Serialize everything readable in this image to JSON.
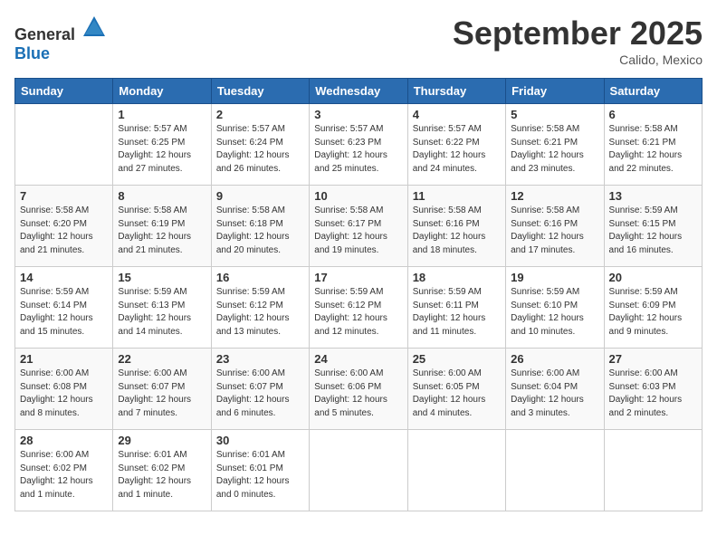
{
  "header": {
    "logo_general": "General",
    "logo_blue": "Blue",
    "title": "September 2025",
    "location": "Calido, Mexico"
  },
  "days_of_week": [
    "Sunday",
    "Monday",
    "Tuesday",
    "Wednesday",
    "Thursday",
    "Friday",
    "Saturday"
  ],
  "weeks": [
    [
      {
        "day": "",
        "info": ""
      },
      {
        "day": "1",
        "info": "Sunrise: 5:57 AM\nSunset: 6:25 PM\nDaylight: 12 hours\nand 27 minutes."
      },
      {
        "day": "2",
        "info": "Sunrise: 5:57 AM\nSunset: 6:24 PM\nDaylight: 12 hours\nand 26 minutes."
      },
      {
        "day": "3",
        "info": "Sunrise: 5:57 AM\nSunset: 6:23 PM\nDaylight: 12 hours\nand 25 minutes."
      },
      {
        "day": "4",
        "info": "Sunrise: 5:57 AM\nSunset: 6:22 PM\nDaylight: 12 hours\nand 24 minutes."
      },
      {
        "day": "5",
        "info": "Sunrise: 5:58 AM\nSunset: 6:21 PM\nDaylight: 12 hours\nand 23 minutes."
      },
      {
        "day": "6",
        "info": "Sunrise: 5:58 AM\nSunset: 6:21 PM\nDaylight: 12 hours\nand 22 minutes."
      }
    ],
    [
      {
        "day": "7",
        "info": "Sunrise: 5:58 AM\nSunset: 6:20 PM\nDaylight: 12 hours\nand 21 minutes."
      },
      {
        "day": "8",
        "info": "Sunrise: 5:58 AM\nSunset: 6:19 PM\nDaylight: 12 hours\nand 21 minutes."
      },
      {
        "day": "9",
        "info": "Sunrise: 5:58 AM\nSunset: 6:18 PM\nDaylight: 12 hours\nand 20 minutes."
      },
      {
        "day": "10",
        "info": "Sunrise: 5:58 AM\nSunset: 6:17 PM\nDaylight: 12 hours\nand 19 minutes."
      },
      {
        "day": "11",
        "info": "Sunrise: 5:58 AM\nSunset: 6:16 PM\nDaylight: 12 hours\nand 18 minutes."
      },
      {
        "day": "12",
        "info": "Sunrise: 5:58 AM\nSunset: 6:16 PM\nDaylight: 12 hours\nand 17 minutes."
      },
      {
        "day": "13",
        "info": "Sunrise: 5:59 AM\nSunset: 6:15 PM\nDaylight: 12 hours\nand 16 minutes."
      }
    ],
    [
      {
        "day": "14",
        "info": "Sunrise: 5:59 AM\nSunset: 6:14 PM\nDaylight: 12 hours\nand 15 minutes."
      },
      {
        "day": "15",
        "info": "Sunrise: 5:59 AM\nSunset: 6:13 PM\nDaylight: 12 hours\nand 14 minutes."
      },
      {
        "day": "16",
        "info": "Sunrise: 5:59 AM\nSunset: 6:12 PM\nDaylight: 12 hours\nand 13 minutes."
      },
      {
        "day": "17",
        "info": "Sunrise: 5:59 AM\nSunset: 6:12 PM\nDaylight: 12 hours\nand 12 minutes."
      },
      {
        "day": "18",
        "info": "Sunrise: 5:59 AM\nSunset: 6:11 PM\nDaylight: 12 hours\nand 11 minutes."
      },
      {
        "day": "19",
        "info": "Sunrise: 5:59 AM\nSunset: 6:10 PM\nDaylight: 12 hours\nand 10 minutes."
      },
      {
        "day": "20",
        "info": "Sunrise: 5:59 AM\nSunset: 6:09 PM\nDaylight: 12 hours\nand 9 minutes."
      }
    ],
    [
      {
        "day": "21",
        "info": "Sunrise: 6:00 AM\nSunset: 6:08 PM\nDaylight: 12 hours\nand 8 minutes."
      },
      {
        "day": "22",
        "info": "Sunrise: 6:00 AM\nSunset: 6:07 PM\nDaylight: 12 hours\nand 7 minutes."
      },
      {
        "day": "23",
        "info": "Sunrise: 6:00 AM\nSunset: 6:07 PM\nDaylight: 12 hours\nand 6 minutes."
      },
      {
        "day": "24",
        "info": "Sunrise: 6:00 AM\nSunset: 6:06 PM\nDaylight: 12 hours\nand 5 minutes."
      },
      {
        "day": "25",
        "info": "Sunrise: 6:00 AM\nSunset: 6:05 PM\nDaylight: 12 hours\nand 4 minutes."
      },
      {
        "day": "26",
        "info": "Sunrise: 6:00 AM\nSunset: 6:04 PM\nDaylight: 12 hours\nand 3 minutes."
      },
      {
        "day": "27",
        "info": "Sunrise: 6:00 AM\nSunset: 6:03 PM\nDaylight: 12 hours\nand 2 minutes."
      }
    ],
    [
      {
        "day": "28",
        "info": "Sunrise: 6:00 AM\nSunset: 6:02 PM\nDaylight: 12 hours\nand 1 minute."
      },
      {
        "day": "29",
        "info": "Sunrise: 6:01 AM\nSunset: 6:02 PM\nDaylight: 12 hours\nand 1 minute."
      },
      {
        "day": "30",
        "info": "Sunrise: 6:01 AM\nSunset: 6:01 PM\nDaylight: 12 hours\nand 0 minutes."
      },
      {
        "day": "",
        "info": ""
      },
      {
        "day": "",
        "info": ""
      },
      {
        "day": "",
        "info": ""
      },
      {
        "day": "",
        "info": ""
      }
    ]
  ]
}
